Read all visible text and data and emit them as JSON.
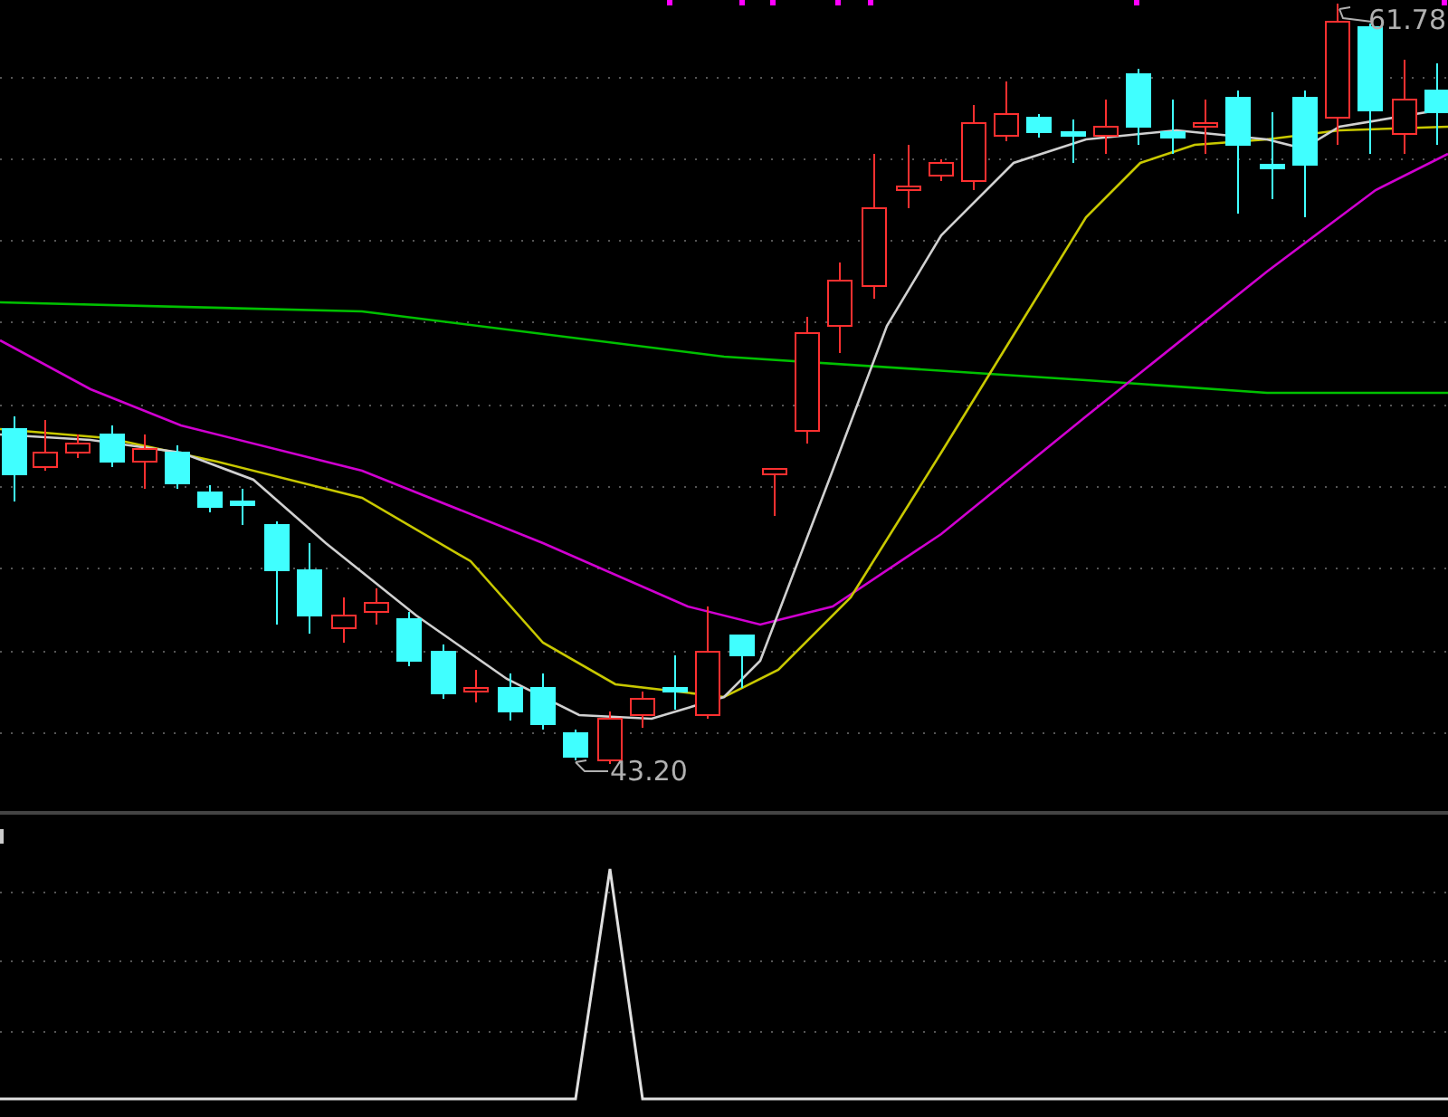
{
  "price_panel": {
    "high_marker": {
      "label": "61.78"
    },
    "low_marker": {
      "label": "43.20"
    }
  }
}
